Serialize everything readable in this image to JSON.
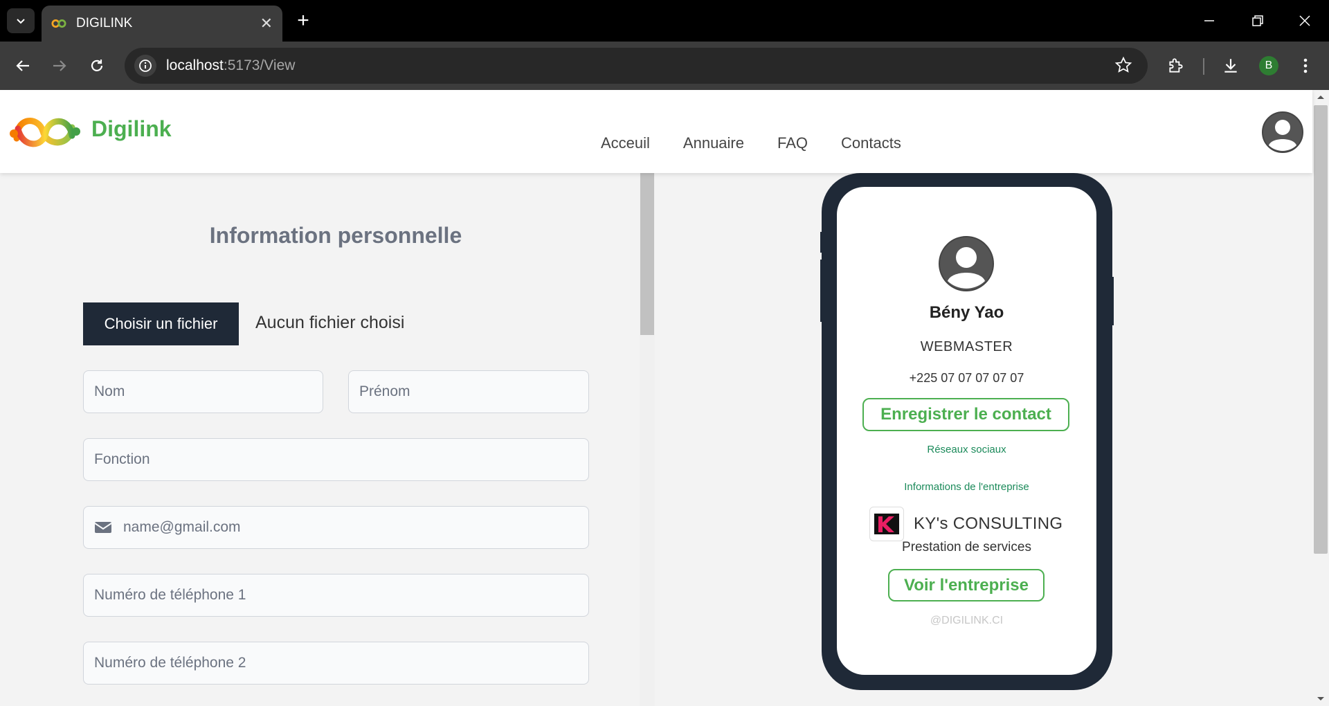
{
  "browser": {
    "tab_title": "DIGILINK",
    "url_host": "localhost",
    "url_path": ":5173/View",
    "profile_initial": "B"
  },
  "header": {
    "brand": "Digilink",
    "nav": [
      "Acceuil",
      "Annuaire",
      "FAQ",
      "Contacts"
    ]
  },
  "form": {
    "title": "Information personnelle",
    "file_button": "Choisir un fichier",
    "file_status": "Aucun fichier choisi",
    "placeholders": {
      "nom": "Nom",
      "prenom": "Prénom",
      "fonction": "Fonction",
      "email": "name@gmail.com",
      "phone1": "Numéro de téléphone 1",
      "phone2": "Numéro de téléphone 2"
    }
  },
  "card": {
    "name": "Bény Yao",
    "role": "WEBMASTER",
    "phone": "+225 07 07 07 07 07",
    "save_contact": "Enregistrer le contact",
    "social_link": "Réseaux sociaux",
    "company_info_link": "Informations de l'entreprise",
    "company_name": "KY's CONSULTING",
    "company_sector": "Prestation de services",
    "view_company": "Voir l'entreprise",
    "footer": "@DIGILINK.CI"
  },
  "colors": {
    "brand_green": "#4caf50",
    "dark": "#1f2937"
  }
}
